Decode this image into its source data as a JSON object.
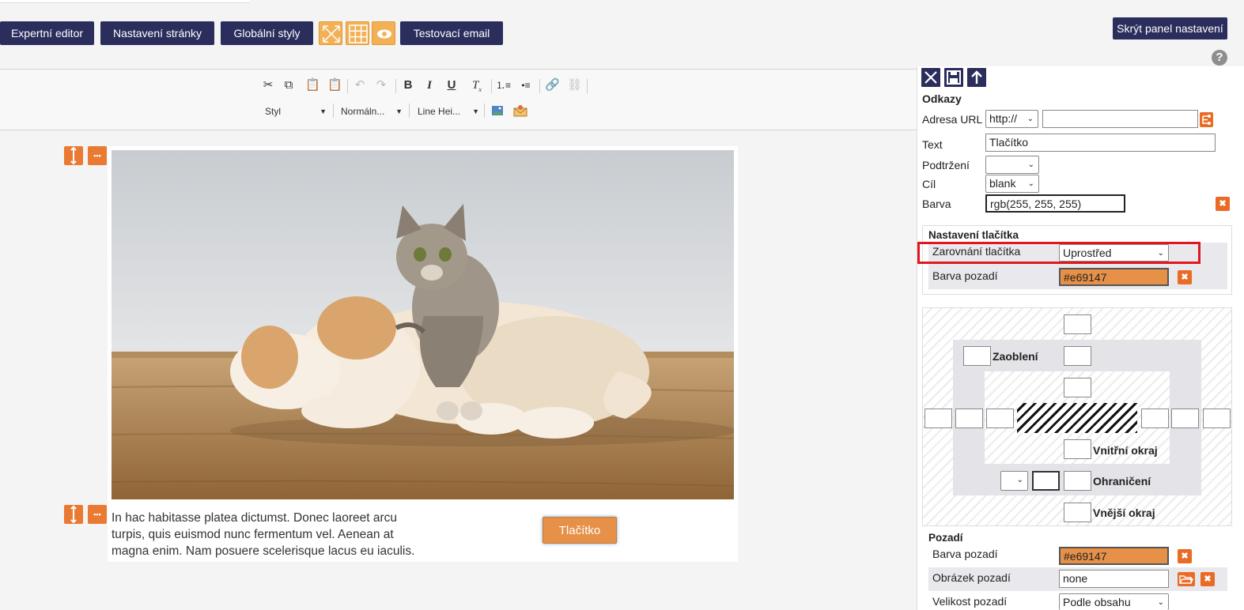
{
  "topbar": {
    "buttons": [
      "Expertní editor",
      "Nastavení stránky",
      "Globální styly"
    ],
    "test_email": "Testovací email",
    "hide_panel": "Skrýt panel nastavení",
    "help": "?"
  },
  "editor_toolbar": {
    "style_combo": "Styl",
    "format_combo": "Normáln...",
    "lineheight_combo": "Line Hei..."
  },
  "content": {
    "body_text": "In hac habitasse platea dictumst. Donec laoreet arcu turpis, quis euismod nunc fermentum vel. Aenean at magna enim. Nam posuere scelerisque lacus eu iaculis.",
    "button_label": "Tlačítko",
    "more_glyph": "•••"
  },
  "panel": {
    "section_links": "Odkazy",
    "url_label": "Adresa URL",
    "url_protocol": "http://",
    "url_value": "",
    "text_label": "Text",
    "text_value": "Tlačítko",
    "underline_label": "Podtržení",
    "underline_value": "",
    "target_label": "Cíl",
    "target_value": "blank",
    "color_label": "Barva",
    "color_value": "rgb(255, 255, 255)",
    "button_settings": "Nastavení tlačítka",
    "align_label": "Zarovnání tlačítka",
    "align_value": "Uprostřed",
    "bg_label": "Barva pozadí",
    "bg_value": "#e69147",
    "boxmodel": {
      "radius": "Zaoblení",
      "padding": "Vnitřní okraj",
      "border": "Ohraničení",
      "margin": "Vnější okraj"
    },
    "section_bg": "Pozadí",
    "bg2_label": "Barva pozadí",
    "bg2_value": "#e69147",
    "bgimg_label": "Obrázek pozadí",
    "bgimg_value": "none",
    "bgsize_label": "Velikost pozadí",
    "bgsize_value": "Podle obsahu"
  },
  "colors": {
    "navy": "#2b2e5c",
    "orange": "#ea7a31",
    "button_bg": "#e69147",
    "highlight": "#e0171f"
  }
}
